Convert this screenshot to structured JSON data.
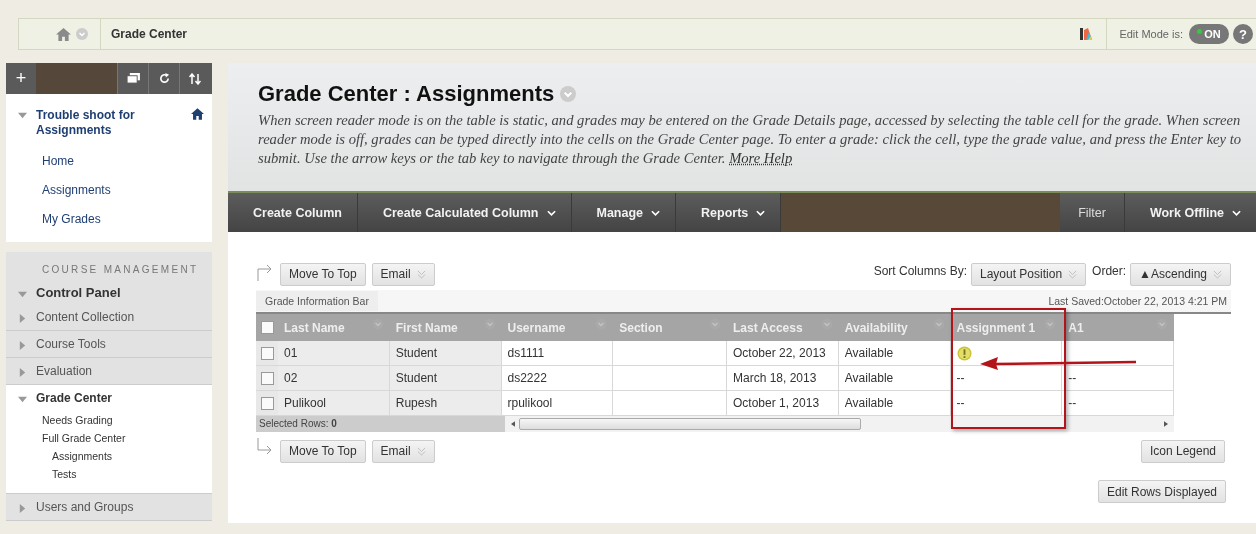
{
  "breadcrumb": {
    "title": "Grade Center"
  },
  "edit_mode": {
    "label": "Edit Mode is:",
    "toggle": "ON",
    "on": true
  },
  "help": "?",
  "sidebar": {
    "add": "+",
    "course": {
      "title": "Trouble shoot for Assignments",
      "expanded": true
    },
    "links": [
      "Home",
      "Assignments",
      "My Grades"
    ],
    "section_heading": "COURSE MANAGEMENT",
    "control_panel": {
      "label": "Control Panel",
      "expanded": true
    },
    "items": [
      {
        "label": "Content Collection",
        "expanded": false,
        "selected": false
      },
      {
        "label": "Course Tools",
        "expanded": false,
        "selected": false
      },
      {
        "label": "Evaluation",
        "expanded": false,
        "selected": false
      },
      {
        "label": "Grade Center",
        "expanded": true,
        "selected": true,
        "children": [
          {
            "label": "Needs Grading"
          },
          {
            "label": "Full Grade Center",
            "children": [
              {
                "label": "Assignments"
              },
              {
                "label": "Tests"
              }
            ]
          }
        ]
      },
      {
        "label": "Users and Groups",
        "expanded": false,
        "selected": false
      }
    ]
  },
  "page": {
    "title": "Grade Center : Assignments",
    "description": "When screen reader mode is on the table is static, and grades may be entered on the Grade Details page, accessed by selecting the table cell for the grade. When screen reader mode is off, grades can be typed directly into the cells on the Grade Center page. To enter a grade: click the cell, type the grade value, and press the Enter key to submit. Use the arrow keys or the tab key to navigate through the Grade Center.",
    "help_link": "More Help"
  },
  "toolbar": {
    "left": [
      {
        "label": "Create Column",
        "dropdown": false
      },
      {
        "label": "Create Calculated Column",
        "dropdown": true
      },
      {
        "label": "Manage",
        "dropdown": true
      },
      {
        "label": "Reports",
        "dropdown": true
      }
    ],
    "right": [
      {
        "label": "Filter",
        "dropdown": false
      },
      {
        "label": "Work Offline",
        "dropdown": true
      }
    ]
  },
  "top_actions": [
    {
      "label": "Move To Top",
      "dropdown": false
    },
    {
      "label": "Email",
      "dropdown": true
    }
  ],
  "sort": {
    "label": "Sort Columns By:",
    "value": "Layout Position",
    "order_label": "Order:",
    "order_value": "▲Ascending"
  },
  "info_bar": {
    "tab": "Grade Information Bar",
    "last_saved": "Last Saved:October 22, 2013 4:21 PM"
  },
  "table": {
    "all_checked": false,
    "columns": [
      "Last Name",
      "First Name",
      "Username",
      "Section",
      "Last Access",
      "Availability",
      "Assignment 1",
      "A1"
    ],
    "rows": [
      {
        "checked": false,
        "cells": [
          "01",
          "Student",
          "ds1111",
          "",
          "October 22, 2013",
          "Available"
        ],
        "grades": [
          {
            "kind": "needs_grading"
          }
        ]
      },
      {
        "checked": false,
        "cells": [
          "02",
          "Student",
          "ds2222",
          "",
          "March 18, 2013",
          "Available"
        ],
        "grades": [
          {
            "kind": "text",
            "text": "--"
          },
          {
            "kind": "text",
            "text": "--"
          }
        ]
      },
      {
        "checked": false,
        "cells": [
          "Pulikool",
          "Rupesh",
          "rpulikool",
          "",
          "October 1, 2013",
          "Available"
        ],
        "grades": [
          {
            "kind": "text",
            "text": "--"
          },
          {
            "kind": "text",
            "text": "--"
          }
        ]
      }
    ],
    "selected_rows": "Selected Rows: **0**"
  },
  "bottom_actions": [
    {
      "label": "Move To Top",
      "dropdown": false
    },
    {
      "label": "Email",
      "dropdown": true
    }
  ],
  "icon_legend": "Icon Legend",
  "edit_rows": "Edit Rows Displayed"
}
